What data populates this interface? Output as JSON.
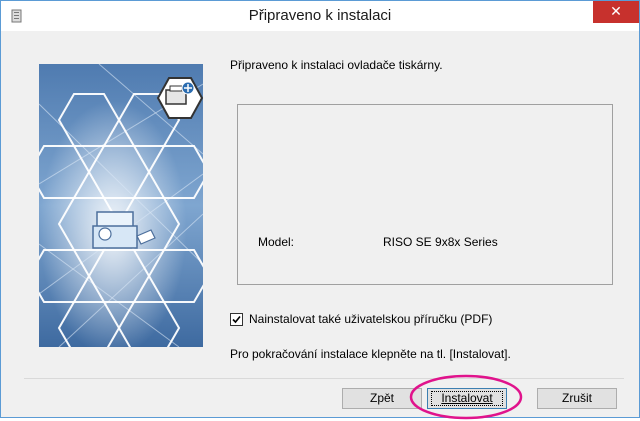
{
  "window": {
    "title": "Připraveno k instalaci",
    "close_symbol": "✕"
  },
  "main": {
    "ready_text": "Připraveno k instalaci ovladače tiskárny.",
    "model_label": "Model:",
    "model_value": "RISO SE 9x8x Series",
    "manual_checkbox": {
      "label": "Nainstalovat také uživatelskou příručku (PDF)",
      "checked": true
    },
    "continue_text": "Pro pokračování instalace klepněte na tl. [Instalovat]."
  },
  "buttons": {
    "back": "Zpět",
    "install": "Instalovat",
    "cancel": "Zrušit"
  },
  "colors": {
    "accent": "#5b9bd5",
    "close": "#c7312d",
    "highlight": "#e0138c",
    "banner_blue": "#5a86b8"
  },
  "icons": {
    "app": "installer-icon",
    "side": "printer-network-illustration",
    "close": "close-icon"
  }
}
